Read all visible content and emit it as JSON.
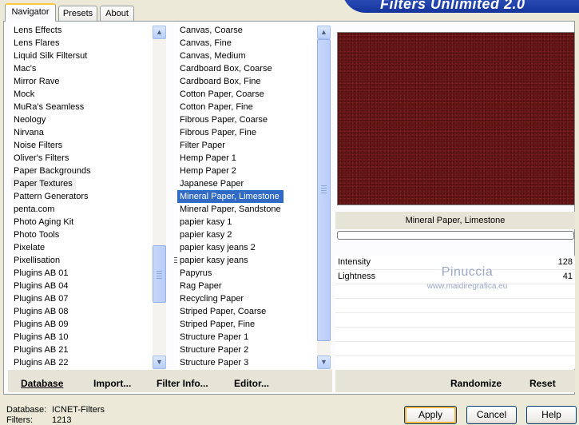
{
  "header": {
    "title": "Filters Unlimited 2.0"
  },
  "tabs": [
    "Navigator",
    "Presets",
    "About"
  ],
  "categories": [
    "Lens Effects",
    "Lens Flares",
    "Liquid Silk Filtersut",
    "Mac's",
    "Mirror Rave",
    "Mock",
    "MuRa's Seamless",
    "Neology",
    "Nirvana",
    "Noise Filters",
    "Oliver's Filters",
    "Paper Backgrounds",
    "Paper Textures",
    "Pattern Generators",
    "penta.com",
    "Photo Aging Kit",
    "Photo Tools",
    "Pixelate",
    "Pixellisation",
    "Plugins AB 01",
    "Plugins AB 04",
    "Plugins AB 07",
    "Plugins AB 08",
    "Plugins AB 09",
    "Plugins AB 10",
    "Plugins AB 21",
    "Plugins AB 22"
  ],
  "categories_selected": "Paper Textures",
  "filters": [
    "Canvas, Coarse",
    "Canvas, Fine",
    "Canvas, Medium",
    "Cardboard Box, Coarse",
    "Cardboard Box, Fine",
    "Cotton Paper, Coarse",
    "Cotton Paper, Fine",
    "Fibrous Paper, Coarse",
    "Fibrous Paper, Fine",
    "Filter Paper",
    "Hemp Paper 1",
    "Hemp Paper 2",
    "Japanese Paper",
    "Mineral Paper, Limestone",
    "Mineral Paper, Sandstone",
    "papier kasy 1",
    "papier kasy 2",
    "papier kasy jeans 2",
    "papier kasy jeans",
    "Papyrus",
    "Rag Paper",
    "Recycling Paper",
    "Striped Paper, Coarse",
    "Striped Paper, Fine",
    "Structure Paper 1",
    "Structure Paper 2",
    "Structure Paper 3"
  ],
  "filters_selected": "Mineral Paper, Limestone",
  "preview": {
    "filter_name": "Mineral Paper, Limestone",
    "color": "#701919"
  },
  "params": [
    {
      "label": "Intensity",
      "value": "128"
    },
    {
      "label": "Lightness",
      "value": "41"
    }
  ],
  "watermark": {
    "name": "Pinuccia",
    "url": "www.maidiregrafica.eu"
  },
  "links": {
    "database": "Database",
    "import": "Import...",
    "filter_info": "Filter Info...",
    "editor": "Editor...",
    "randomize": "Randomize",
    "reset": "Reset"
  },
  "footer": {
    "database_label": "Database:",
    "database_value": "ICNET-Filters",
    "filters_label": "Filters:",
    "filters_value": "1213"
  },
  "buttons": {
    "apply": "Apply",
    "cancel": "Cancel",
    "help": "Help"
  },
  "colors": {
    "selection": "#316AC5",
    "tab_highlight": "#FFC83C",
    "banner": "#14349C"
  }
}
